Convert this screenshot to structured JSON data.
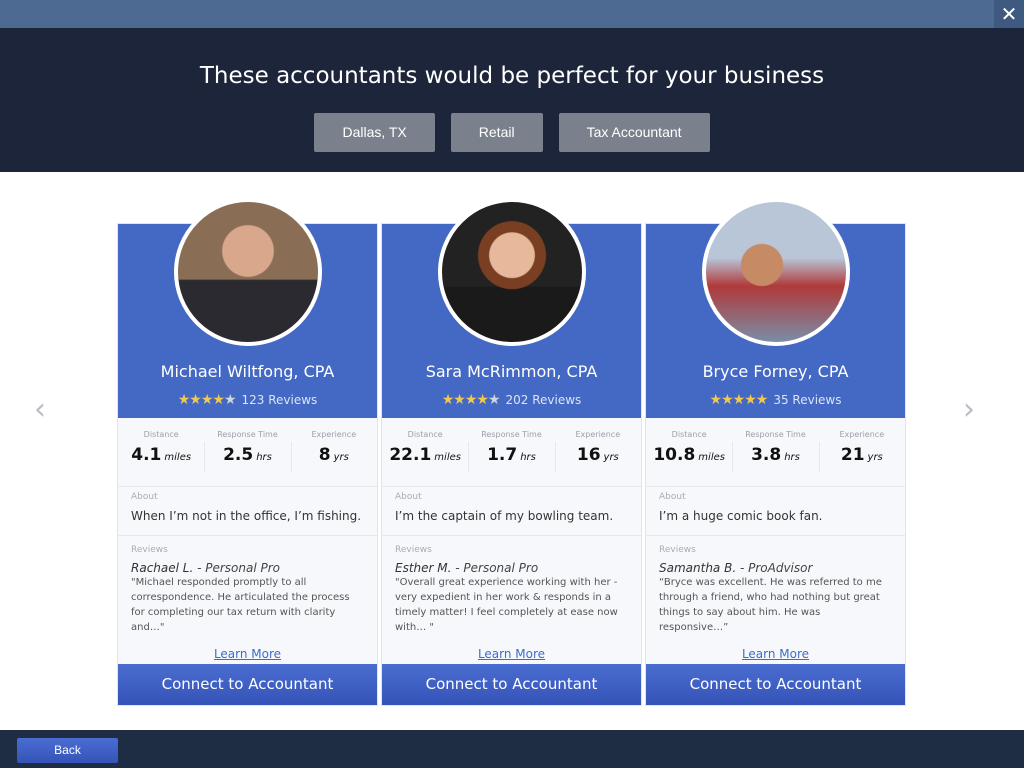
{
  "header": {
    "title": "These accountants would be perfect for your business",
    "filters": [
      "Dallas, TX",
      "Retail",
      "Tax Accountant"
    ]
  },
  "labels": {
    "distance": "Distance",
    "response": "Response Time",
    "experience": "Experience",
    "about": "About",
    "reviews": "Reviews",
    "learn_more": "Learn More",
    "connect": "Connect to Accountant",
    "back": "Back",
    "close": "✕",
    "prev": "‹",
    "next": "›"
  },
  "accent": "#4469c4",
  "cards": [
    {
      "name": "Michael Wiltfong, CPA",
      "rating": 4,
      "reviews": "123 Reviews",
      "distance": "4.1",
      "distance_unit": "miles",
      "response": "2.5",
      "response_unit": "hrs",
      "experience": "8",
      "experience_unit": "yrs",
      "about": "When I’m not in the office, I’m fishing.",
      "reviewer": "Rachael L.",
      "reviewer_role": " - Personal Pro",
      "review": "\"Michael responded promptly to all correspondence. He articulated the process for completing our tax return with clarity and…\""
    },
    {
      "name": "Sara McRimmon, CPA",
      "rating": 4,
      "reviews": "202 Reviews",
      "distance": "22.1",
      "distance_unit": "miles",
      "response": "1.7",
      "response_unit": "hrs",
      "experience": "16",
      "experience_unit": "yrs",
      "about": "I’m the captain of my bowling team.",
      "reviewer": "Esther M.",
      "reviewer_role": " - Personal Pro",
      "review": "\"Overall great experience working with her - very expedient in her work & responds in a timely matter! I feel completely at ease now with… \""
    },
    {
      "name": "Bryce Forney, CPA",
      "rating": 5,
      "reviews": "35 Reviews",
      "distance": "10.8",
      "distance_unit": "miles",
      "response": "3.8",
      "response_unit": "hrs",
      "experience": "21",
      "experience_unit": "yrs",
      "about": "I’m a huge comic book fan.",
      "reviewer": "Samantha B.",
      "reviewer_role": " - ProAdvisor",
      "review": "“Bryce was excellent. He was referred to me through a friend, who had nothing but great things to say about him. He was responsive…”"
    }
  ]
}
